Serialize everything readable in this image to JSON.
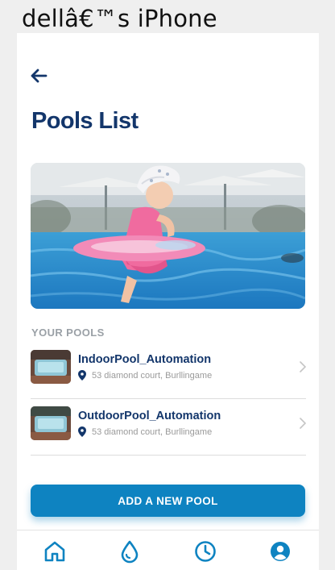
{
  "device": {
    "label": "dellâ€™s iPhone"
  },
  "header": {
    "back_icon": "back-arrow-icon",
    "title": "Pools List"
  },
  "section": {
    "your_pools_label": "YOUR POOLS"
  },
  "pools": [
    {
      "name": "IndoorPool_Automation",
      "address": "53 diamond court, Burllingame"
    },
    {
      "name": "OutdoorPool_Automation",
      "address": "53 diamond court, Burllingame"
    }
  ],
  "actions": {
    "add_pool_label": "ADD A NEW POOL"
  },
  "tab_bar": {
    "tabs": [
      {
        "icon": "home-icon",
        "active": true
      },
      {
        "icon": "water-drop-icon",
        "active": false
      },
      {
        "icon": "clock-icon",
        "active": false
      },
      {
        "icon": "profile-icon",
        "active": false
      }
    ]
  },
  "colors": {
    "title": "#13366b",
    "accent": "#0e83c1",
    "muted": "#9aa0a6",
    "background": "#efefef"
  }
}
